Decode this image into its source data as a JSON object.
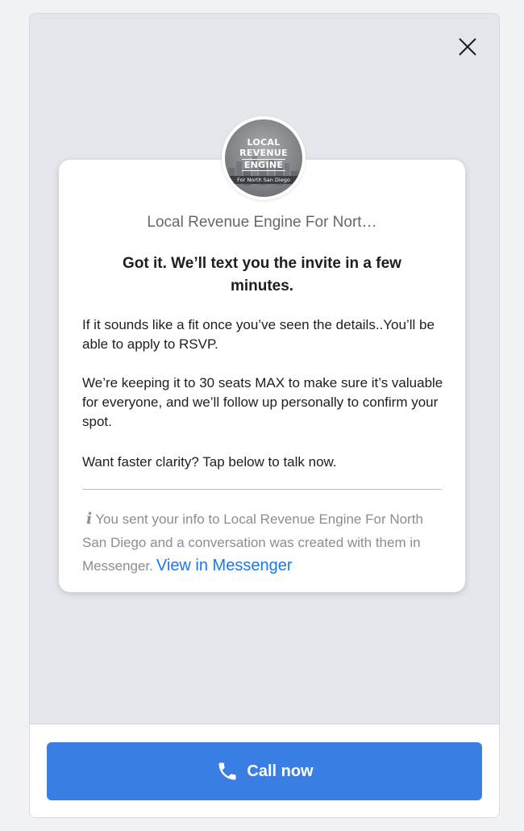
{
  "avatar": {
    "line1": "LOCAL",
    "line2": "REVENUE",
    "line3": "ENGINE",
    "strip": "For North San Diego"
  },
  "card": {
    "page_name": "Local Revenue Engine For Nort…",
    "headline": "Got it. We’ll text you the invite in a few minutes.",
    "paragraphs": [
      "If it sounds like a fit once you’ve seen the details..You’ll be able to apply to RSVP.",
      "We’re keeping it to 30 seats MAX to make sure it’s valuable for everyone, and we’ll follow up personally to confirm your spot.",
      "Want faster clarity? Tap below to talk now."
    ],
    "info_icon": "i",
    "info_text": "You sent your info to Local Revenue Engine For North San Diego and a conversation was created with them in Messenger.",
    "info_link": "View in Messenger"
  },
  "footer": {
    "call_label": "Call now"
  },
  "icons": {
    "close": "close-icon",
    "phone": "phone-icon",
    "info": "info-icon"
  },
  "colors": {
    "accent": "#3a7ee4",
    "link": "#1877f2"
  }
}
